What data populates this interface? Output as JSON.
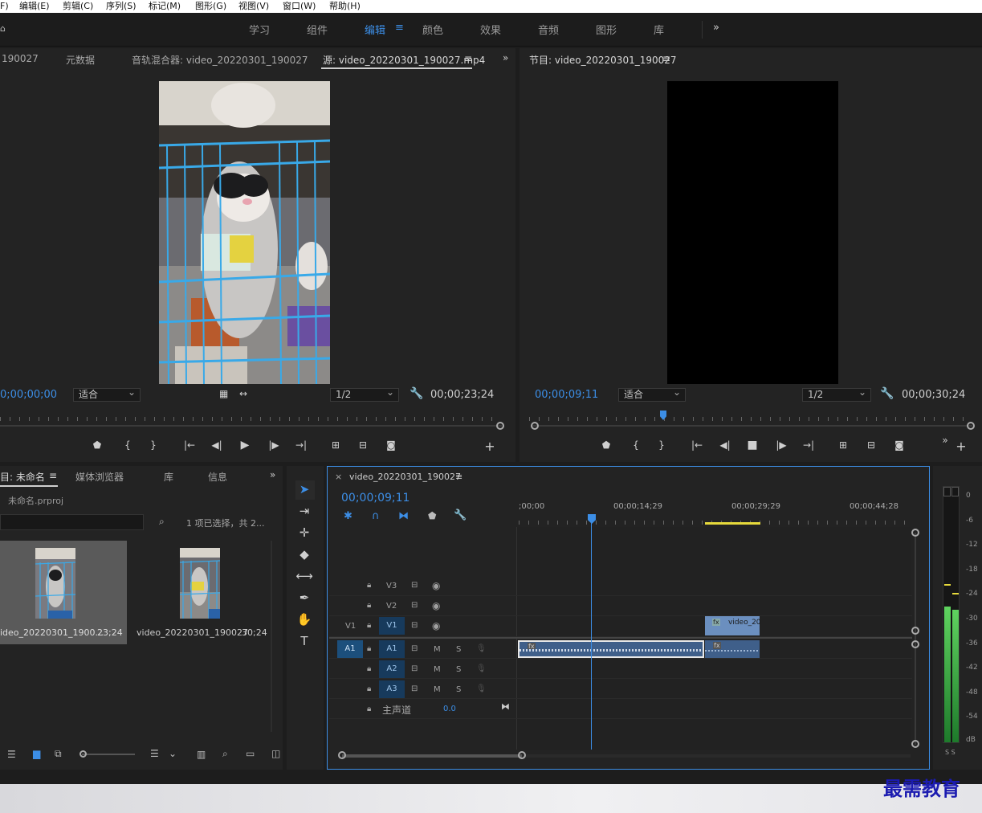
{
  "menu": [
    "F)",
    "编辑(E)",
    "剪辑(C)",
    "序列(S)",
    "标记(M)",
    "图形(G)",
    "视图(V)",
    "窗口(W)",
    "帮助(H)"
  ],
  "workspaces": [
    "学习",
    "组件",
    "编辑",
    "颜色",
    "效果",
    "音频",
    "图形",
    "库"
  ],
  "workspace_active": "编辑",
  "workspace_more": "»",
  "source_panel": {
    "tabs": [
      "190027",
      "元数据",
      "音轨混合器: video_20220301_190027",
      "源: video_20220301_190027.mp4"
    ],
    "menu_icon": "≡",
    "more": "»",
    "timecode": "0;00;00;00",
    "fit": "适合",
    "resolution": "1/2",
    "duration": "00;00;23;24"
  },
  "program_panel": {
    "tab": "节目: video_20220301_190027",
    "menu_icon": "≡",
    "timecode": "00;00;09;11",
    "fit": "适合",
    "resolution": "1/2",
    "duration": "00;00;30;24",
    "more": "»"
  },
  "project_panel": {
    "tabs": [
      "目: 未命名",
      "媒体浏览器",
      "库",
      "信息"
    ],
    "menu_icon": "≡",
    "more": "»",
    "filename": "未命名.prproj",
    "selection_info": "1 项已选择，共 2...",
    "items": [
      {
        "name": "ideo_20220301_1900...",
        "duration": "23;24"
      },
      {
        "name": "video_20220301_190027",
        "duration": "30;24"
      }
    ]
  },
  "timeline": {
    "close": "×",
    "sequence_name": "video_20220301_190027",
    "menu_icon": "≡",
    "timecode": "00;00;09;11",
    "ruler_labels": [
      ";00;00",
      "00;00;14;29",
      "00;00;29;29",
      "00;00;44;28"
    ],
    "tracks_video": [
      {
        "label": "V3",
        "src": ""
      },
      {
        "label": "V2",
        "src": ""
      },
      {
        "label": "V1",
        "src": "V1"
      }
    ],
    "tracks_audio": [
      {
        "label": "A1",
        "src": "A1",
        "m": "M",
        "s": "S"
      },
      {
        "label": "A2",
        "src": "",
        "m": "M",
        "s": "S"
      },
      {
        "label": "A3",
        "src": "",
        "m": "M",
        "s": "S"
      }
    ],
    "master_label": "主声道",
    "master_value": "0.0",
    "clip_video_label": "video_20"
  },
  "meter": {
    "labels": [
      "0",
      "-6",
      "-12",
      "-18",
      "-24",
      "-30",
      "-36",
      "-42",
      "-48",
      "-54",
      "dB"
    ],
    "solo": "S S"
  },
  "watermark": "最需教育",
  "colors": {
    "accent": "#3c8ee6",
    "panel_bg": "#232323",
    "clip_video": "#6b8fbf",
    "clip_audio": "#3f5f8a",
    "in_out": "#e6d93c"
  }
}
